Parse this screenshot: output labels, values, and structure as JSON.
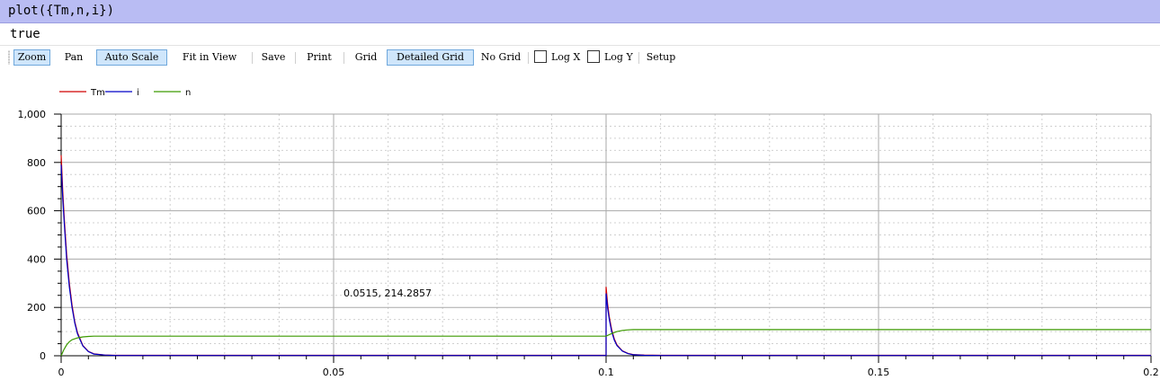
{
  "command": {
    "text": "plot({Tm,n,i})"
  },
  "result": {
    "text": "true"
  },
  "toolbar": {
    "zoom": "Zoom",
    "pan": "Pan",
    "auto_scale": "Auto Scale",
    "fit_in_view": "Fit in View",
    "save": "Save",
    "print": "Print",
    "grid": "Grid",
    "detailed_grid": "Detailed Grid",
    "no_grid": "No Grid",
    "log_x": "Log X",
    "log_y": "Log Y",
    "setup": "Setup",
    "active": [
      "zoom",
      "auto_scale",
      "detailed_grid"
    ],
    "log_x_checked": false,
    "log_y_checked": false
  },
  "chart_data": {
    "type": "line",
    "title": "",
    "xlabel": "",
    "ylabel": "",
    "xlim": [
      0,
      0.2
    ],
    "ylim": [
      0,
      1000
    ],
    "x_ticks": [
      {
        "value": 0,
        "label": "0"
      },
      {
        "value": 0.05,
        "label": "0.05"
      },
      {
        "value": 0.1,
        "label": "0.1"
      },
      {
        "value": 0.15,
        "label": "0.15"
      },
      {
        "value": 0.2,
        "label": "0.2"
      }
    ],
    "y_ticks": [
      {
        "value": 0,
        "label": "0"
      },
      {
        "value": 200,
        "label": "200"
      },
      {
        "value": 400,
        "label": "400"
      },
      {
        "value": 600,
        "label": "600"
      },
      {
        "value": 800,
        "label": "800"
      },
      {
        "value": 1000,
        "label": "1,000"
      }
    ],
    "grid": "detailed",
    "legend_position": "top-left",
    "cursor_readout": "0.0515, 214.2857",
    "series": [
      {
        "name": "Tm",
        "color": "#d00000",
        "x": [
          0,
          0.0003,
          0.0006,
          0.001,
          0.0015,
          0.002,
          0.0025,
          0.003,
          0.004,
          0.005,
          0.006,
          0.008,
          0.01,
          0.02,
          0.05,
          0.1,
          0.1,
          0.1003,
          0.1006,
          0.101,
          0.1015,
          0.102,
          0.103,
          0.104,
          0.105,
          0.107,
          0.11,
          0.15,
          0.2
        ],
        "y": [
          830,
          680,
          560,
          420,
          300,
          210,
          140,
          95,
          42,
          18,
          8,
          3,
          2,
          2,
          2,
          2,
          285,
          210,
          160,
          110,
          70,
          45,
          20,
          10,
          5,
          3,
          2,
          2,
          2
        ]
      },
      {
        "name": "i",
        "color": "#0000c8",
        "x": [
          0,
          0.0003,
          0.0006,
          0.001,
          0.0015,
          0.002,
          0.0025,
          0.003,
          0.004,
          0.005,
          0.006,
          0.008,
          0.01,
          0.02,
          0.05,
          0.1,
          0.1,
          0.1003,
          0.1006,
          0.101,
          0.1015,
          0.102,
          0.103,
          0.104,
          0.105,
          0.107,
          0.11,
          0.15,
          0.2
        ],
        "y": [
          790,
          650,
          540,
          400,
          285,
          200,
          135,
          90,
          40,
          17,
          7,
          3,
          1,
          1,
          1,
          1,
          258,
          195,
          150,
          102,
          65,
          42,
          19,
          9,
          4,
          2,
          1,
          1,
          1
        ]
      },
      {
        "name": "n",
        "color": "#3c9a00",
        "x": [
          0,
          0.0005,
          0.001,
          0.0015,
          0.002,
          0.003,
          0.004,
          0.005,
          0.006,
          0.008,
          0.01,
          0.05,
          0.1,
          0.101,
          0.102,
          0.103,
          0.104,
          0.105,
          0.106,
          0.108,
          0.11,
          0.15,
          0.2
        ],
        "y": [
          0,
          25,
          45,
          58,
          66,
          74,
          78,
          80,
          81,
          81,
          81,
          81,
          81,
          92,
          100,
          105,
          107,
          108,
          108,
          108,
          108,
          108,
          108
        ]
      }
    ]
  }
}
